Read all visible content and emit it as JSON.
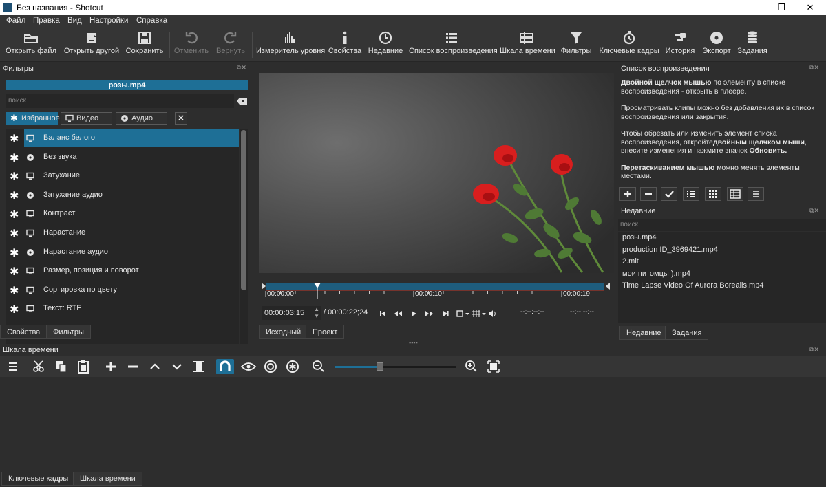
{
  "window": {
    "title": "Без названия - Shotcut",
    "controls": [
      "—",
      "❐",
      "✕"
    ]
  },
  "menu": [
    "Файл",
    "Правка",
    "Вид",
    "Настройки",
    "Справка"
  ],
  "toolbar": [
    {
      "label": "Открыть файл",
      "icon": "folder-open-icon",
      "enabled": true
    },
    {
      "label": "Открыть другой",
      "icon": "open-other-icon",
      "enabled": true
    },
    {
      "label": "Сохранить",
      "icon": "save-icon",
      "enabled": true
    },
    {
      "label": "Отменить",
      "icon": "undo-icon",
      "enabled": false
    },
    {
      "label": "Вернуть",
      "icon": "redo-icon",
      "enabled": false
    },
    {
      "label": "Измеритель уровня",
      "icon": "level-meter-icon",
      "enabled": true
    },
    {
      "label": "Свойства",
      "icon": "info-icon",
      "enabled": true
    },
    {
      "label": "Недавние",
      "icon": "clock-icon",
      "enabled": true
    },
    {
      "label": "Список воспроизведения",
      "icon": "list-icon",
      "enabled": true
    },
    {
      "label": "Шкала времени",
      "icon": "timeline-icon",
      "enabled": true
    },
    {
      "label": "Фильтры",
      "icon": "funnel-icon",
      "enabled": true
    },
    {
      "label": "Ключевые кадры",
      "icon": "stopwatch-icon",
      "enabled": true
    },
    {
      "label": "История",
      "icon": "history-icon",
      "enabled": true
    },
    {
      "label": "Экспорт",
      "icon": "disc-icon",
      "enabled": true
    },
    {
      "label": "Задания",
      "icon": "database-icon",
      "enabled": true
    }
  ],
  "filters": {
    "title": "Фильтры",
    "clip_name": "розы.mp4",
    "search_placeholder": "поиск",
    "chips": [
      "Избранное",
      "Видео",
      "Аудио"
    ],
    "items": [
      {
        "name": "Баланс белого",
        "kind": "video",
        "selected": true
      },
      {
        "name": "Без звука",
        "kind": "audio",
        "selected": false
      },
      {
        "name": "Затухание",
        "kind": "video",
        "selected": false
      },
      {
        "name": "Затухание аудио",
        "kind": "audio",
        "selected": false
      },
      {
        "name": "Контраст",
        "kind": "video",
        "selected": false
      },
      {
        "name": "Нарастание",
        "kind": "video",
        "selected": false
      },
      {
        "name": "Нарастание аудио",
        "kind": "audio",
        "selected": false
      },
      {
        "name": "Размер, позиция и поворот",
        "kind": "video",
        "selected": false
      },
      {
        "name": "Сортировка по цвету",
        "kind": "video",
        "selected": false
      },
      {
        "name": "Текст: RTF",
        "kind": "video",
        "selected": false
      }
    ],
    "tabs": [
      "Свойства",
      "Фильтры"
    ]
  },
  "player": {
    "ruler": [
      "00:00:00",
      "00:00:10",
      "00:00:19"
    ],
    "position": "00:00:03;15",
    "duration": "/ 00:00:22;24",
    "in_point": "--:--:--:--",
    "out_point": "--:--:--:--",
    "tabs": [
      "Исходный",
      "Проект"
    ]
  },
  "playlist": {
    "title": "Список воспроизведения",
    "help": [
      {
        "bold": "Двойной щелчок мышью",
        "rest": " по элементу в списке воспроизведения - открыть в плеере."
      },
      {
        "bold": "",
        "rest": "Просматривать клипы можно без добавления их в список воспроизведения или закрытия."
      },
      {
        "bold": "",
        "rest": "Чтобы обрезать или изменить элемент списка воспроизведения, откройте",
        "bold2": "двойным щелчком мыши",
        "rest2": ", внесите изменения и нажмите значок ",
        "bold3": "Обновить."
      },
      {
        "bold": "Перетаскиванием мышью",
        "rest": " можно менять элементы местами."
      }
    ]
  },
  "recent": {
    "title": "Недавние",
    "search_placeholder": "поиск",
    "items": [
      "розы.mp4",
      "production ID_3969421.mp4",
      "2.mlt",
      "мои питомцы ).mp4",
      "Time Lapse Video Of Aurora Borealis.mp4"
    ],
    "tabs": [
      "Недавние",
      "Задания"
    ]
  },
  "timeline": {
    "title": "Шкала времени",
    "zoom_level": 0.34
  },
  "bottom_tabs": [
    "Ключевые кадры",
    "Шкала времени"
  ],
  "colors": {
    "accent": "#1e6f96",
    "panel": "#2d2d2d",
    "toolbar": "#353535",
    "field": "#262626"
  }
}
